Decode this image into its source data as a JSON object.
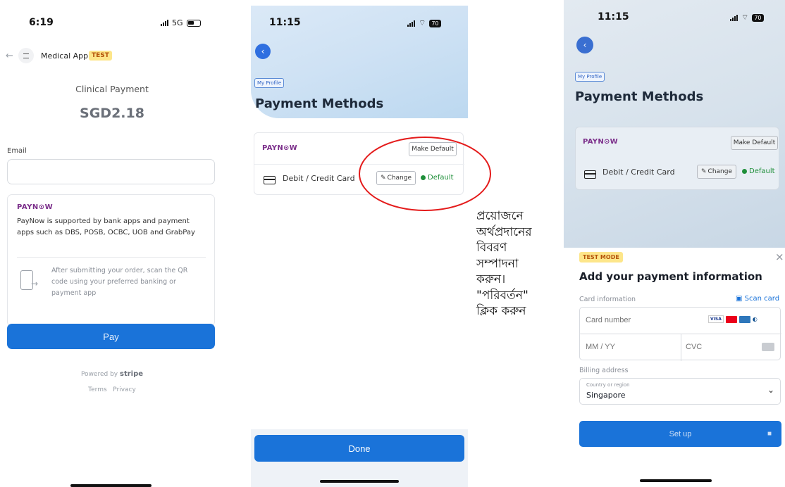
{
  "screen1": {
    "status_time": "6:19",
    "status_network": "5G",
    "header_title": "Medical App",
    "header_badge": "TEST",
    "payment_title": "Clinical Payment",
    "amount": "SGD2.18",
    "email_label": "Email",
    "email_value": "",
    "paynow_logo": "PAYN⊙W",
    "paynow_desc": "PayNow is supported by bank apps and payment apps such as DBS, POSB, OCBC, UOB and GrabPay",
    "instruction": "After submitting your order, scan the QR code using your preferred banking or payment app",
    "pay_label": "Pay",
    "powered_by": "Powered by",
    "stripe": "stripe",
    "terms": "Terms",
    "privacy": "Privacy",
    "accent": "#1a73d9"
  },
  "screen2": {
    "status_time": "11:15",
    "battery": "70",
    "breadcrumb": "My Profile",
    "title": "Payment Methods",
    "paynow_logo": "PAYN⊙W",
    "make_default_label": "Make Default",
    "card_label": "Debit / Credit Card",
    "change_label": "Change",
    "default_label": "Default",
    "done_label": "Done",
    "accent": "#1a73d9",
    "default_color": "#1f8f3a"
  },
  "screen3": {
    "status_time": "11:15",
    "battery": "70",
    "breadcrumb": "My Profile",
    "title": "Payment Methods",
    "paynow_logo": "PAYN⊙W",
    "make_default_label": "Make Default",
    "card_label": "Debit / Credit Card",
    "change_label": "Change",
    "default_label": "Default",
    "test_mode": "TEST MODE",
    "sheet_title": "Add your payment information",
    "card_info_label": "Card information",
    "scan_card": "Scan card",
    "card_number_placeholder": "Card number",
    "expiry_placeholder": "MM / YY",
    "cvc_placeholder": "CVC",
    "billing_label": "Billing address",
    "country_label": "Country or region",
    "country_value": "Singapore",
    "setup_label": "Set up"
  },
  "annotation": {
    "lines": [
      "প্রয়োজনে",
      "অর্থপ্রদানের",
      "বিবরণ",
      "সম্পাদনা",
      "করুন।",
      "\"পরিবর্তন\"",
      "ক্লিক করুন"
    ],
    "highlight_color": "#e41b1b"
  }
}
